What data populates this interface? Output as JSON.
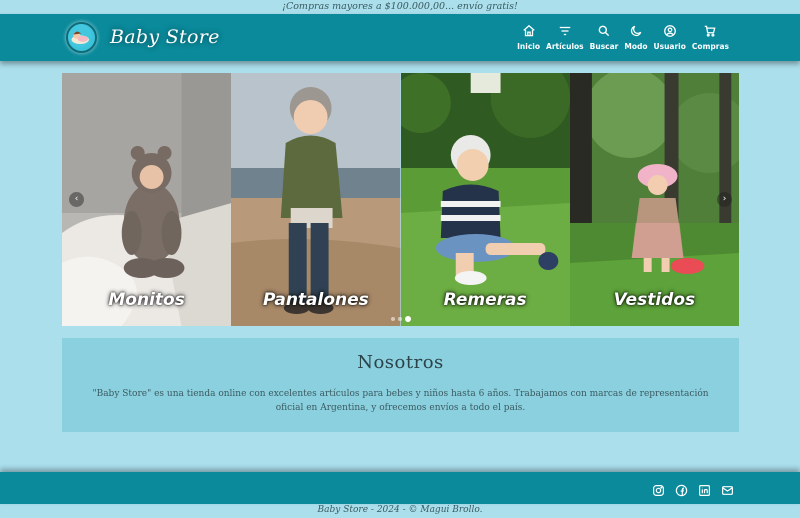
{
  "promo_bar": {
    "text": "¡Compras mayores a $100.000,00... envío gratis!"
  },
  "header": {
    "brand": "Baby Store",
    "nav": [
      {
        "label": "Inicio",
        "icon": "home-icon"
      },
      {
        "label": "Artículos",
        "icon": "filter-icon"
      },
      {
        "label": "Buscar",
        "icon": "search-icon"
      },
      {
        "label": "Modo",
        "icon": "moon-icon"
      },
      {
        "label": "Usuario",
        "icon": "user-icon"
      },
      {
        "label": "Compras",
        "icon": "cart-icon"
      }
    ]
  },
  "carousel": {
    "slides": [
      {
        "caption": "Monitos"
      },
      {
        "caption": "Pantalones"
      },
      {
        "caption": "Remeras"
      },
      {
        "caption": "Vestidos"
      }
    ],
    "prev_icon": "chevron-left-icon",
    "next_icon": "chevron-right-icon",
    "active_dot": 3,
    "dot_count": 3
  },
  "about": {
    "title": "Nosotros",
    "text": "\"Baby Store\" es una tienda online con excelentes artículos para bebes y niños hasta 6 años. Trabajamos con marcas de representación oficial en Argentina, y ofrecemos envíos a todo el país."
  },
  "footer": {
    "social": [
      "instagram-icon",
      "facebook-icon",
      "linkedin-icon",
      "mail-icon"
    ],
    "copyright": "Baby Store - 2024 - © Magui Brollo."
  },
  "colors": {
    "primary": "#0a8a9b",
    "background": "#abdfec",
    "panel": "#8bd0de"
  }
}
